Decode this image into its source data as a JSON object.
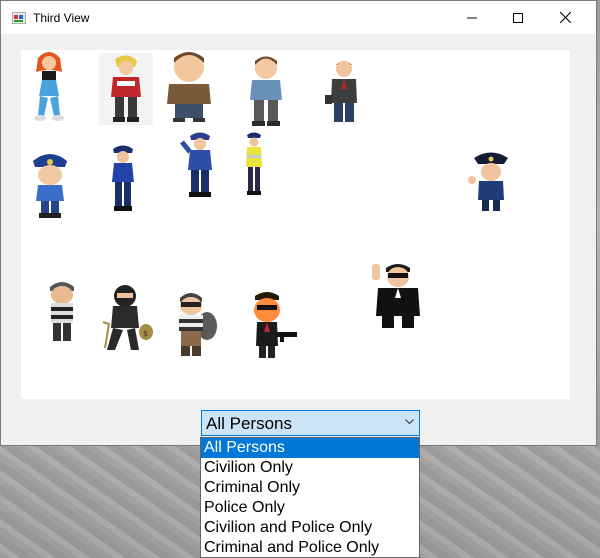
{
  "window": {
    "title": "Third View"
  },
  "characters": {
    "civilians": [
      "girl-hero-icon",
      "boy-sweater-icon",
      "man-brown-shirt-icon",
      "man-blue-shirt-icon",
      "man-suit-icon"
    ],
    "police": [
      "police-boy-icon",
      "police-woman-icon",
      "police-man-saluting-icon",
      "traffic-officer-icon",
      "police-officer-waving-icon"
    ],
    "criminals": [
      "robber-striped-icon",
      "thief-moneybag-icon",
      "burglar-sack-icon",
      "gangster-gun-icon",
      "bodyguard-sunglasses-icon"
    ]
  },
  "filter": {
    "selected": "All Persons",
    "options": [
      "All Persons",
      "Civilion Only",
      "Criminal Only",
      "Police Only",
      "Civilion and Police Only",
      "Criminal and Police Only"
    ]
  },
  "colors": {
    "selection": "#0078d7",
    "combo_focus": "#cce4f7"
  }
}
